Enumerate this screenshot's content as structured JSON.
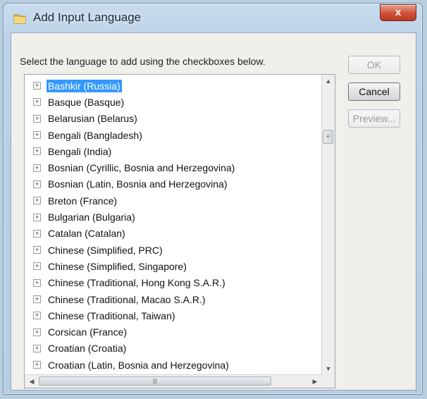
{
  "window": {
    "title": "Add Input Language",
    "close_glyph": "x"
  },
  "dialog": {
    "instruction": "Select the language to add using the checkboxes below."
  },
  "buttons": {
    "ok": "OK",
    "cancel": "Cancel",
    "preview": "Preview..."
  },
  "languages": [
    "Bashkir (Russia)",
    "Basque (Basque)",
    "Belarusian (Belarus)",
    "Bengali (Bangladesh)",
    "Bengali (India)",
    "Bosnian (Cyrillic, Bosnia and Herzegovina)",
    "Bosnian (Latin, Bosnia and Herzegovina)",
    "Breton (France)",
    "Bulgarian (Bulgaria)",
    "Catalan (Catalan)",
    "Chinese (Simplified, PRC)",
    "Chinese (Simplified, Singapore)",
    "Chinese (Traditional, Hong Kong S.A.R.)",
    "Chinese (Traditional, Macao S.A.R.)",
    "Chinese (Traditional, Taiwan)",
    "Corsican (France)",
    "Croatian (Croatia)",
    "Croatian (Latin, Bosnia and Herzegovina)"
  ],
  "selected_index": 0,
  "expander_glyph": "+",
  "icons": {
    "window": "folder-icon",
    "scroll_up": "chevron-up-icon",
    "scroll_down": "chevron-down-icon",
    "scroll_left": "chevron-left-icon",
    "scroll_right": "chevron-right-icon"
  },
  "colors": {
    "selection": "#3399ff",
    "title_bar": "#bcd2e8",
    "close_button": "#cf4f37"
  }
}
